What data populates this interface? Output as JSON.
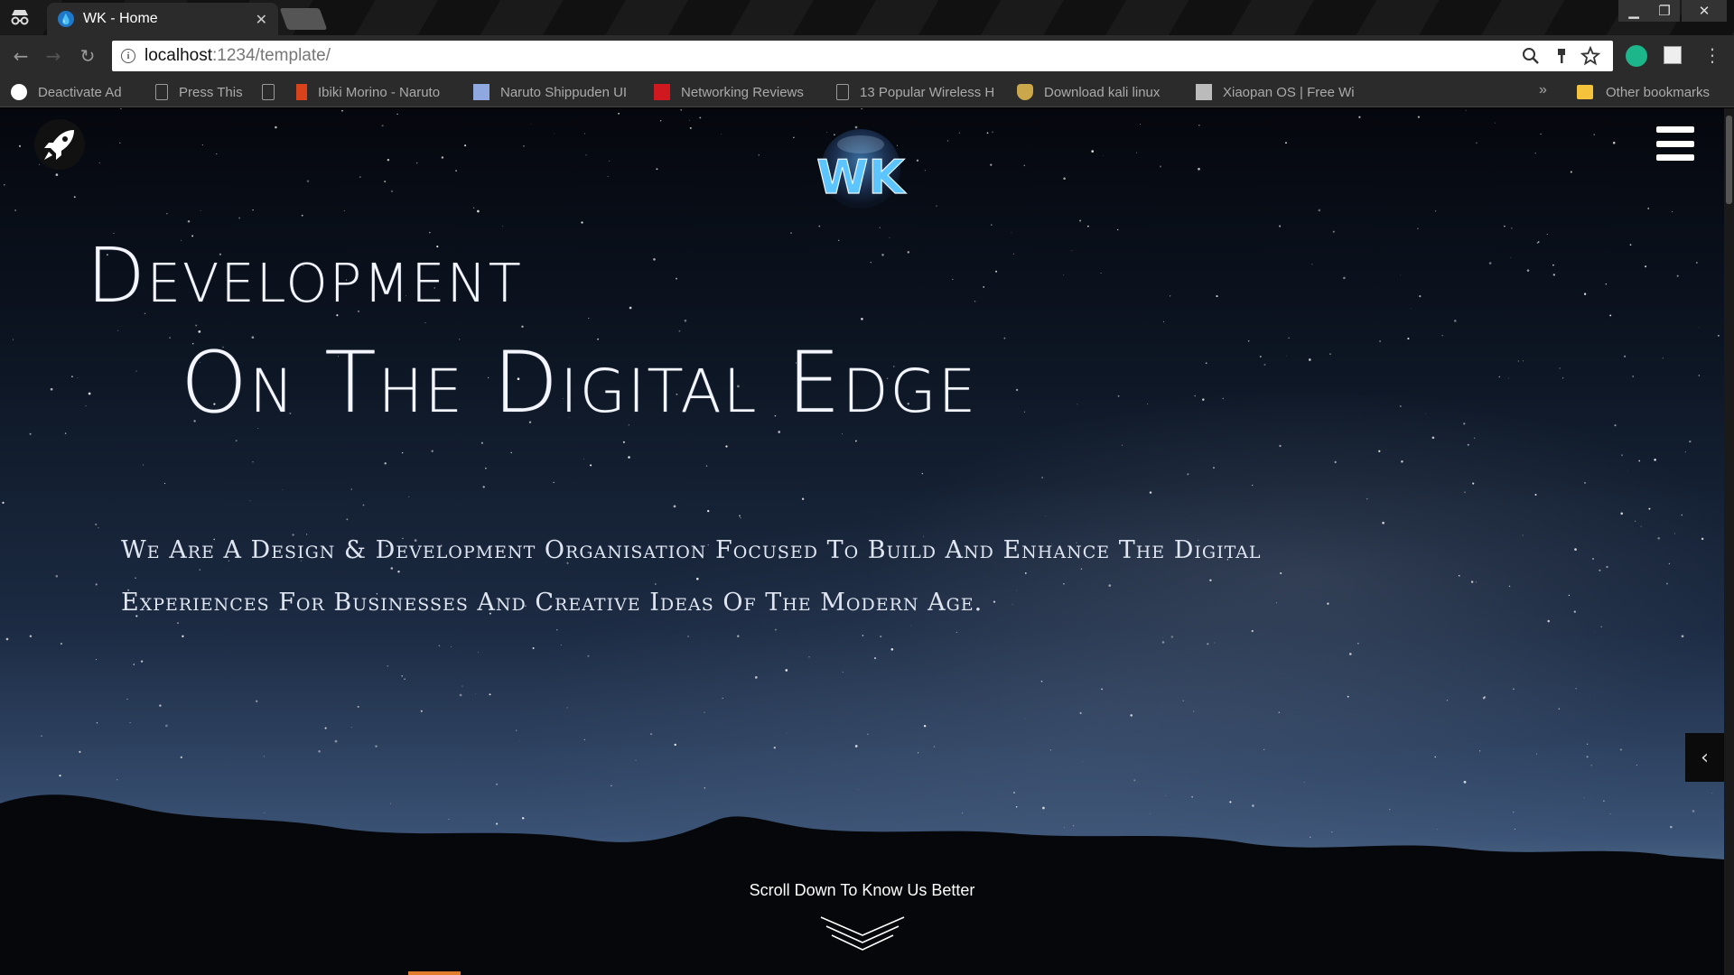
{
  "browser": {
    "tab_title": "WK - Home",
    "url_host": "localhost",
    "url_path": ":1234/template/",
    "bookmarks": [
      {
        "label": "Deactivate Ad",
        "icon": "olx-icon"
      },
      {
        "label": "Press This",
        "icon": "page-icon"
      },
      {
        "label": "",
        "icon": "page-icon"
      },
      {
        "label": "Ibiki Morino - Naruto",
        "icon": "naruto-icon"
      },
      {
        "label": "Naruto Shippuden UI",
        "icon": "wiki-icon"
      },
      {
        "label": "Networking Reviews",
        "icon": "pc-icon"
      },
      {
        "label": "13 Popular Wireless H",
        "icon": "page-icon"
      },
      {
        "label": "Download kali linux",
        "icon": "shield-icon"
      },
      {
        "label": "Xiaopan OS | Free Wi",
        "icon": "xiaopan-icon"
      }
    ],
    "other_bookmarks": "Other bookmarks",
    "chevron": "»"
  },
  "page": {
    "logo_text": "WK",
    "hero_line1": "Development",
    "hero_line2": "On The Digital Edge",
    "tagline_line1": "We Are A Design & Development Organisation Focused To Build And Enhance The Digital",
    "tagline_line2": "Experiences For Businesses And Creative Ideas Of The Modern Age.",
    "scroll_text": "Scroll Down To Know Us Better"
  },
  "colors": {
    "accent": "#e17d2a",
    "logo_blue": "#4fb3ff"
  }
}
